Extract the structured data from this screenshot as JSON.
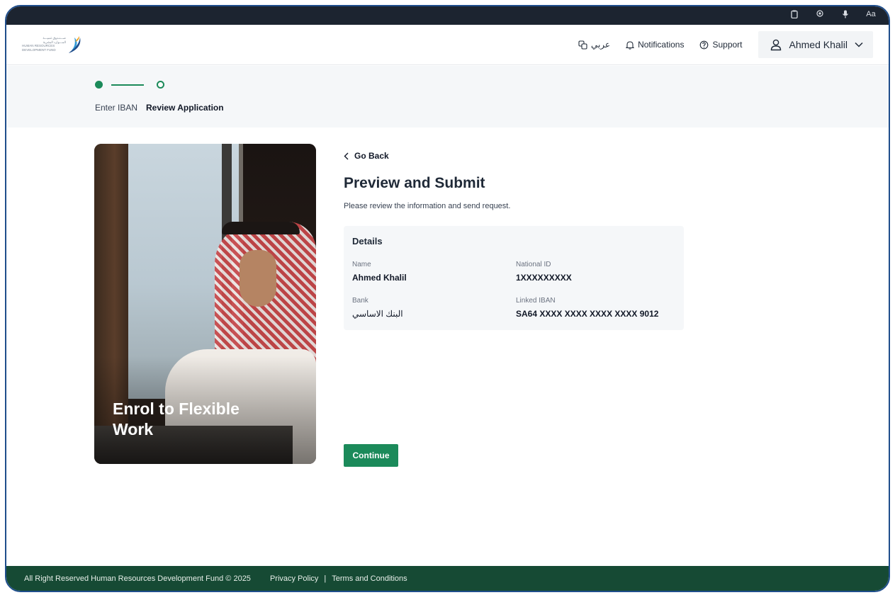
{
  "system_bar": {
    "icons": [
      "clipboard-icon",
      "eye-icon",
      "microphone-icon",
      "text-size-icon"
    ],
    "text_size_label": "Aa"
  },
  "header": {
    "logo": {
      "arabic_line1": "صـــنـدوق تنميـــة",
      "arabic_line2": "المـــوارد البشرية",
      "english_line1": "HUMAN RESOURCES",
      "english_line2": "DEVELOPMENT FUND"
    },
    "language_label": "عربي",
    "notifications_label": "Notifications",
    "support_label": "Support",
    "user_name": "Ahmed Khalil"
  },
  "stepper": {
    "steps": [
      {
        "label": "Enter IBAN",
        "state": "completed"
      },
      {
        "label": "Review Application",
        "state": "current"
      }
    ]
  },
  "hero": {
    "caption": "Enrol to Flexible Work"
  },
  "main": {
    "go_back_label": "Go Back",
    "title": "Preview and Submit",
    "subtitle": "Please review the information and send request.",
    "details": {
      "heading": "Details",
      "fields": {
        "name_label": "Name",
        "name_value": "Ahmed Khalil",
        "national_id_label": "National ID",
        "national_id_value": "1XXXXXXXXX",
        "bank_label": "Bank",
        "bank_value": "البنك الاساسي",
        "iban_label": "Linked IBAN",
        "iban_value": "SA64 XXXX XXXX XXXX XXXX 9012"
      }
    },
    "continue_label": "Continue"
  },
  "footer": {
    "copyright": "All Right Reserved Human Resources Development Fund © 2025",
    "privacy_label": "Privacy Policy",
    "separator": "|",
    "terms_label": "Terms and Conditions"
  },
  "colors": {
    "brand_green": "#1b8a5a",
    "footer_green": "#164a34",
    "system_bar": "#1c2430",
    "panel_bg": "#f5f7f9"
  }
}
